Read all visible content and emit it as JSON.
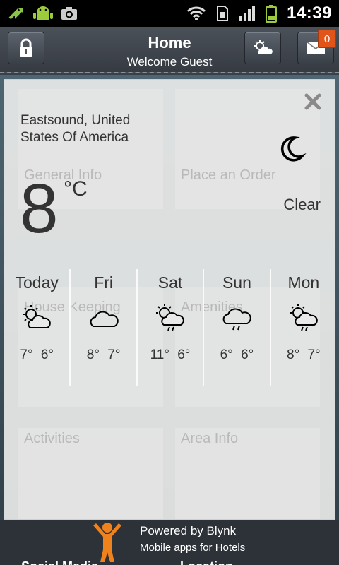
{
  "status_bar": {
    "time": "14:39",
    "icons": [
      "usb-debug-icon",
      "android-icon",
      "camera-icon",
      "wifi-icon",
      "sim-icon",
      "signal-icon",
      "battery-icon"
    ]
  },
  "header": {
    "title": "Home",
    "subtitle": "Welcome Guest",
    "mail_badge": "0",
    "icons": [
      "lock-icon",
      "weather-icon",
      "mail-icon"
    ]
  },
  "background_tiles": [
    {
      "label": "General Info"
    },
    {
      "label": "Place an Order"
    },
    {
      "label": "House Keeping"
    },
    {
      "label": "Amenities"
    },
    {
      "label": "Activities"
    },
    {
      "label": "Area Info"
    }
  ],
  "weather": {
    "location": "Eastsound, United States Of America",
    "temperature": "8",
    "unit": "°C",
    "condition": "Clear",
    "condition_icon": "moon-icon",
    "forecast": [
      {
        "day": "Today",
        "high": "7°",
        "low": "6°",
        "icon": "partly-cloudy-icon"
      },
      {
        "day": "Fri",
        "high": "8°",
        "low": "7°",
        "icon": "cloud-icon"
      },
      {
        "day": "Sat",
        "high": "11°",
        "low": "6°",
        "icon": "sun-rain-icon"
      },
      {
        "day": "Sun",
        "high": "6°",
        "low": "6°",
        "icon": "rain-icon"
      },
      {
        "day": "Mon",
        "high": "8°",
        "low": "7°",
        "icon": "sun-rain-icon"
      }
    ]
  },
  "footer": {
    "line1": "Powered by Blynk",
    "line2": "Mobile apps for Hotels",
    "below_left": "Social Media",
    "below_right": "Location"
  },
  "colors": {
    "badge": "#e2551a",
    "header": "#3f454c",
    "card": "#e8e9e8"
  }
}
